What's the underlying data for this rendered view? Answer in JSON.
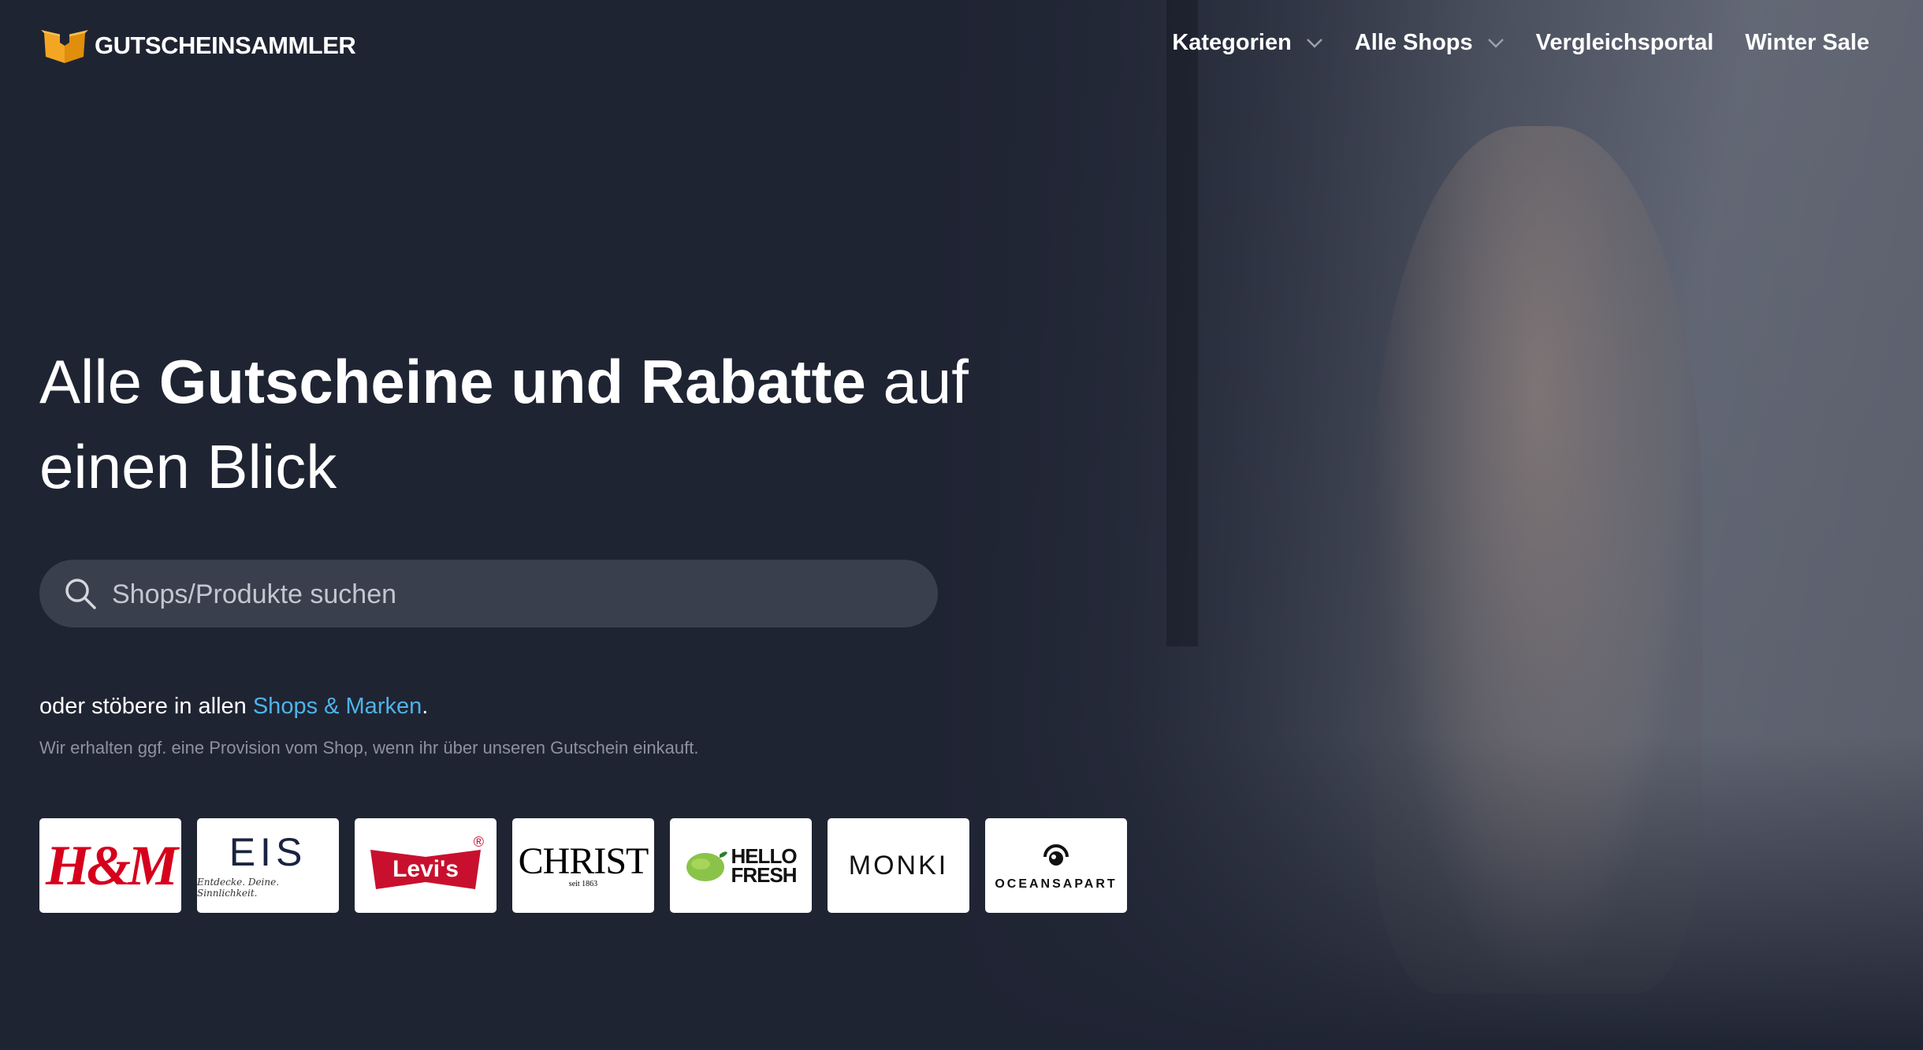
{
  "header": {
    "logo_text": "GUTSCHEINSAMMLER",
    "nav": [
      {
        "label": "Kategorien",
        "has_dropdown": true
      },
      {
        "label": "Alle Shops",
        "has_dropdown": true
      },
      {
        "label": "Vergleichsportal",
        "has_dropdown": false
      },
      {
        "label": "Winter Sale",
        "has_dropdown": false
      }
    ]
  },
  "hero": {
    "headline_pre": "Alle ",
    "headline_bold": "Gutscheine und Rabatte",
    "headline_post": " auf einen Blick",
    "search_placeholder": "Shops/Produkte suchen",
    "browse_pre": "oder stöbere in allen ",
    "browse_link": "Shops & Marken",
    "browse_post": ".",
    "disclaimer": "Wir erhalten ggf. eine Provision vom Shop, wenn ihr über unseren Gutschein einkauft."
  },
  "brands": [
    {
      "name": "H&M",
      "logo_text": "H&M"
    },
    {
      "name": "EIS",
      "logo_text": "EIS",
      "tagline": "Entdecke. Deine. Sinnlichkeit."
    },
    {
      "name": "Levi's",
      "logo_text": "Levi's",
      "mark": "®"
    },
    {
      "name": "Christ",
      "logo_text": "CHRIST",
      "tagline": "seit 1863"
    },
    {
      "name": "HelloFresh",
      "logo_line1": "HELLO",
      "logo_line2": "FRESH"
    },
    {
      "name": "Monki",
      "logo_text": "MONKI"
    },
    {
      "name": "Oceansapart",
      "logo_text": "OCEANSAPART"
    }
  ],
  "colors": {
    "background": "#1f2433",
    "accent_link": "#4fb3e8",
    "logo_orange": "#f4a623",
    "search_bg": "#3a3f4d"
  }
}
